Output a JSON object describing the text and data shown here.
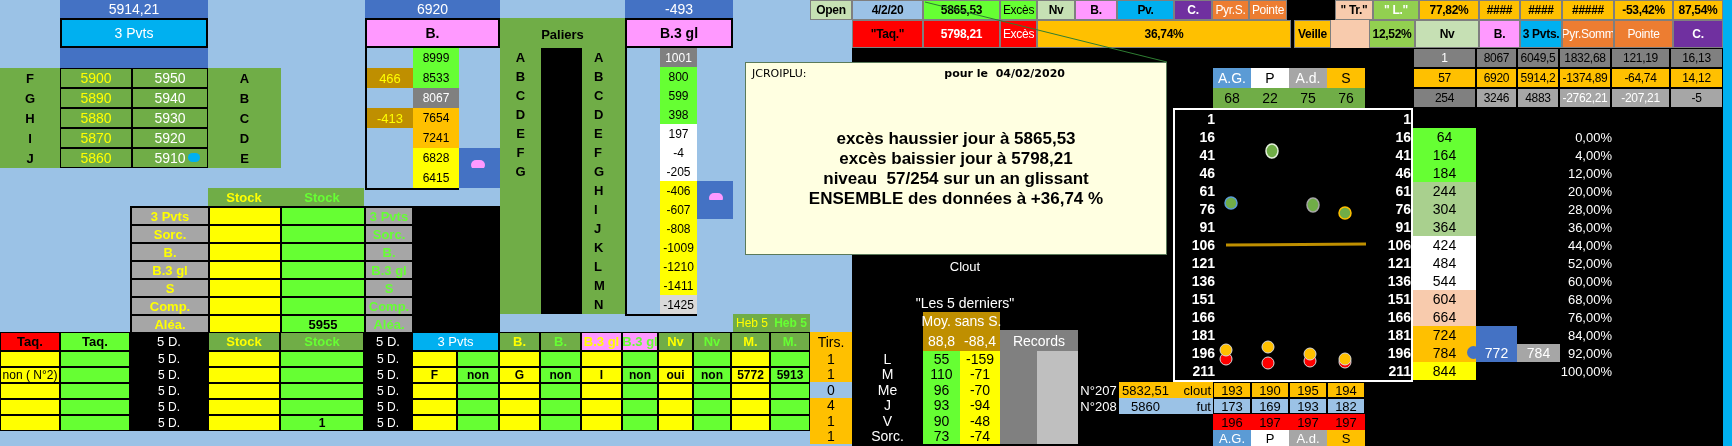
{
  "pivots": {
    "value": "5914,21",
    "title": "3 Pvts",
    "rows": [
      {
        "left": "F",
        "low": "5900",
        "high": "5950",
        "right": "A",
        "marked": false
      },
      {
        "left": "G",
        "low": "5890",
        "high": "5940",
        "right": "B",
        "marked": false
      },
      {
        "left": "H",
        "low": "5880",
        "high": "5930",
        "right": "C",
        "marked": false
      },
      {
        "left": "I",
        "low": "5870",
        "high": "5920",
        "right": "D",
        "marked": false
      },
      {
        "left": "J",
        "low": "5860",
        "high": "5910",
        "right": "E",
        "marked": true
      }
    ]
  },
  "b_block": {
    "value": "6920",
    "title": "B.",
    "rows": [
      {
        "value": "8999",
        "color": "#66ff33",
        "highlight": false,
        "marked": false
      },
      {
        "diff": "466",
        "value": "8533",
        "color": "#66ff33",
        "highlight": false,
        "marked": false
      },
      {
        "value": "8067",
        "color": "#808080",
        "highlight": false,
        "marked": false
      },
      {
        "diff": "-413",
        "value": "7654",
        "color": "#ffc000",
        "highlight": false,
        "marked": false
      },
      {
        "value": "7241",
        "color": "#ffc000",
        "highlight": false,
        "marked": false
      },
      {
        "value": "6828",
        "color": "#ffff00",
        "highlight": true,
        "marked": true
      },
      {
        "value": "6415",
        "color": "#ffff00",
        "highlight": true,
        "marked": false
      }
    ]
  },
  "paliers": {
    "title": "Paliers",
    "left_labels": [
      "A",
      "B",
      "C",
      "D",
      "E",
      "F",
      "G"
    ],
    "right_labels": [
      "A",
      "B",
      "C",
      "D",
      "E",
      "F",
      "G",
      "H",
      "I",
      "J",
      "K",
      "L",
      "M",
      "N"
    ]
  },
  "b3_block": {
    "value": "-493",
    "title": "B.3 gl",
    "rows": [
      {
        "value": "1001",
        "color": "#808080",
        "highlight": false,
        "marked": false
      },
      {
        "value": "800",
        "color": "#66ff33",
        "highlight": false,
        "marked": false
      },
      {
        "value": "599",
        "color": "#66ff33",
        "highlight": false,
        "marked": false
      },
      {
        "value": "398",
        "color": "#66ff33",
        "highlight": false,
        "marked": false
      },
      {
        "value": "197",
        "color": "#ffffff",
        "highlight": false,
        "marked": false
      },
      {
        "value": "-4",
        "color": "#ffffff",
        "highlight": false,
        "marked": false
      },
      {
        "value": "-205",
        "color": "#ffffff",
        "highlight": false,
        "marked": false
      },
      {
        "value": "-406",
        "color": "#ffff00",
        "highlight": true,
        "marked": true
      },
      {
        "value": "-607",
        "color": "#ffff00",
        "highlight": true,
        "marked": false
      },
      {
        "value": "-808",
        "color": "#ffff00",
        "highlight": false,
        "marked": false
      },
      {
        "value": "-1009",
        "color": "#ffff00",
        "highlight": false,
        "marked": false
      },
      {
        "value": "-1210",
        "color": "#ffff00",
        "highlight": false,
        "marked": false
      },
      {
        "value": "-1411",
        "color": "#ffff00",
        "highlight": false,
        "marked": false
      },
      {
        "value": "-1425",
        "color": "#d9d9d9",
        "highlight": false,
        "marked": false
      }
    ]
  },
  "stock_table": {
    "headers": [
      "Stock",
      "Stock"
    ],
    "rows": [
      {
        "label": "3 Pvts",
        "mirror": "3 Pvts"
      },
      {
        "label": "Sorc.",
        "mirror": "Sorc."
      },
      {
        "label": "B.",
        "mirror": "B."
      },
      {
        "label": "B.3 gl",
        "mirror": "B.3 gl"
      },
      {
        "label": "S",
        "mirror": "S"
      },
      {
        "label": "Comp.",
        "mirror": "Comp."
      },
      {
        "label": "Aléa.",
        "mirror": "Aléa.",
        "stock": "5955"
      }
    ]
  },
  "lower_table": {
    "heb": [
      "Heb 5",
      "Heb 5"
    ],
    "headers": [
      {
        "text": "Taq.",
        "color": "#ff0000",
        "kind": "dark"
      },
      {
        "text": "Taq.",
        "color": "#66ff33",
        "kind": "dark"
      },
      {
        "text": "5 D.",
        "color": "#000000",
        "kind": "soft"
      },
      {
        "text": "Stock",
        "color": "#70ad47",
        "kind": "gold"
      },
      {
        "text": "Stock",
        "color": "#70ad47",
        "kind": "lime"
      },
      {
        "text": "5 D.",
        "color": "#000000",
        "kind": "soft"
      },
      {
        "text": "3 Pvts",
        "color": "#00b0f0",
        "kind": "soft"
      },
      {
        "text": "B.",
        "color": "#70ad47",
        "kind": "gold"
      },
      {
        "text": "B.",
        "color": "#70ad47",
        "kind": "lime"
      },
      {
        "text": "B.3 gl",
        "color": "#ff99ff",
        "kind": "gold"
      },
      {
        "text": "B.3 gl",
        "color": "#ff99ff",
        "kind": "lime"
      },
      {
        "text": "Nv",
        "color": "#70ad47",
        "kind": "gold"
      },
      {
        "text": "Nv",
        "color": "#70ad47",
        "kind": "lime"
      },
      {
        "text": "M.",
        "color": "#70ad47",
        "kind": "gold"
      },
      {
        "text": "M.",
        "color": "#70ad47",
        "kind": "lime"
      }
    ],
    "rows": [
      {
        "d5_a": "5 D.",
        "d5_b": "5 D."
      },
      {
        "taq": "non ( N°2)",
        "d5_a": "5 D.",
        "d5_b": "5 D.",
        "pvts_a": "F",
        "pvts_b": "non",
        "b_a": "G",
        "b_b": "non",
        "b3_a": "I",
        "b3_b": "non",
        "nv_a": "oui",
        "nv_b": "non",
        "m_a": "5772",
        "m_b": "5913"
      },
      {
        "d5_a": "5 D.",
        "d5_b": "5 D."
      },
      {
        "d5_a": "5 D.",
        "d5_b": "5 D."
      },
      {
        "d5_a": "5 D.",
        "stock_b": "1",
        "d5_b": "5 D."
      }
    ]
  },
  "top_bar": {
    "row_1": [
      {
        "text": "Open",
        "color": "#c6e0b4",
        "kind": "dark"
      },
      {
        "text": "4/2/20",
        "color": "#9bc2e6",
        "kind": "dark"
      },
      {
        "text": "5865,53",
        "color": "#66ff33",
        "kind": "dark"
      },
      {
        "text": "Excès",
        "color": "#66ff33",
        "kind": "plain"
      },
      {
        "text": "Nv",
        "color": "#c6e0b4",
        "kind": "dark"
      },
      {
        "text": "B.",
        "color": "#ff99ff",
        "kind": "dark"
      },
      {
        "text": "Pv.",
        "color": "#00b0f0",
        "kind": "dark"
      },
      {
        "text": "C.",
        "color": "#7030a0",
        "kind": "light"
      },
      {
        "text": "Pyr.S.",
        "color": "#ed7d31",
        "kind": "soft"
      },
      {
        "text": "Pointe",
        "color": "#ed7d31",
        "kind": "soft"
      },
      {
        "color": "#000000",
        "kind": "plain"
      },
      {
        "text": "\" Tr.\"",
        "color": "#f8cbad",
        "kind": "dark"
      },
      {
        "text": "\" L.\"",
        "color": "#92d050",
        "kind": "light"
      },
      {
        "text": "77,82%",
        "color": "#ffc000",
        "kind": "dark"
      },
      {
        "text": "####",
        "color": "#ffc000",
        "kind": "dark"
      },
      {
        "text": "####",
        "color": "#ffc000",
        "kind": "dark"
      },
      {
        "text": "#####",
        "color": "#ffc000",
        "kind": "dark"
      },
      {
        "text": "-53,42%",
        "color": "#ffc000",
        "kind": "dark"
      },
      {
        "text": "87,54%",
        "color": "#ffc000",
        "kind": "dark"
      }
    ],
    "row_2": [
      {
        "text": "\"Taq.\"",
        "color": "#ff0000",
        "kind": "dark"
      },
      {
        "text": "5798,21",
        "color": "#ff0000",
        "kind": "light"
      },
      {
        "text": "Excès",
        "color": "#ff0000",
        "kind": "soft"
      },
      {
        "text": "36,74%",
        "color": "#ffc000",
        "kind": "dark"
      },
      {
        "color": "#000000",
        "kind": "plain"
      },
      {
        "text": "Veille",
        "color": "#ffc000",
        "kind": "dark"
      },
      {
        "color": "#f8cbad",
        "kind": "plain"
      },
      {
        "text": "12,52%",
        "color": "#92d050",
        "kind": "dark"
      },
      {
        "text": "Nv",
        "color": "#c6e0b4",
        "kind": "dark"
      },
      {
        "text": "B.",
        "color": "#ff99ff",
        "kind": "dark"
      },
      {
        "text": "3 Pvts.",
        "color": "#00b0f0",
        "kind": "dark"
      },
      {
        "text": "Pyr.Somm",
        "color": "#ed7d31",
        "kind": "soft"
      },
      {
        "text": "Pointe",
        "color": "#ed7d31",
        "kind": "soft"
      },
      {
        "text": "C.",
        "color": "#7030a0",
        "kind": "light"
      }
    ]
  },
  "summary_table": {
    "rows": [
      [
        {
          "text": "1",
          "color": "#808080",
          "kind": "soft"
        },
        {
          "text": "8067",
          "color": "#808080",
          "kind": "plain"
        },
        {
          "text": "6049,5",
          "color": "#808080",
          "kind": "plain"
        },
        {
          "text": "1832,68",
          "color": "#808080",
          "kind": "plain"
        },
        {
          "text": "121,19",
          "color": "#808080",
          "kind": "plain"
        },
        {
          "text": "16,13",
          "color": "#808080",
          "kind": "plain"
        }
      ],
      [
        {
          "text": "57",
          "color": "#ffc000",
          "kind": "plain"
        },
        {
          "text": "6920",
          "color": "#ffc000",
          "kind": "plain"
        },
        {
          "text": "5914,2",
          "color": "#ffc000",
          "kind": "plain"
        },
        {
          "text": "-1374,89",
          "color": "#ffc000",
          "kind": "plain"
        },
        {
          "text": "-64,74",
          "color": "#ffc000",
          "kind": "plain"
        },
        {
          "text": "14,12",
          "color": "#ffc000",
          "kind": "plain"
        }
      ],
      [
        {
          "text": "254",
          "color": "#808080",
          "kind": "plain"
        },
        {
          "text": "3246",
          "color": "#a6a6a6",
          "kind": "plain"
        },
        {
          "text": "4883",
          "color": "#a6a6a6",
          "kind": "plain"
        },
        {
          "text": "-2762,21",
          "color": "#a6a6a6",
          "kind": "soft"
        },
        {
          "text": "-207,21",
          "color": "#a6a6a6",
          "kind": "soft"
        },
        {
          "text": "-5",
          "color": "#a6a6a6",
          "kind": "plain"
        }
      ]
    ]
  },
  "groups": {
    "headers": [
      {
        "text": "A.G.",
        "color": "#5b9bd5",
        "kind": "soft"
      },
      {
        "text": "P",
        "color": "#ffffff",
        "kind": "plain"
      },
      {
        "text": "A.d.",
        "color": "#a6a6a6",
        "kind": "soft"
      },
      {
        "text": "S",
        "color": "#ffc000",
        "kind": "plain"
      }
    ],
    "values": [
      "68",
      "22",
      "75",
      "76"
    ]
  },
  "note": {
    "author": "JCROIPLU:",
    "date": "pour le  04/02/2020",
    "lines": [
      "excès haussier jour à 5865,53",
      "excès baissier jour à 5798,21",
      "niveau  57/254 sur un an glissant",
      "ENSEMBLE des données à +36,74 %"
    ]
  },
  "tirs": {
    "title": "Tirs.",
    "rows": [
      {
        "text": "1",
        "color": "#ffc000"
      },
      {
        "text": "1",
        "color": "#ffc000"
      },
      {
        "text": "0",
        "color": "#9bc2e6"
      },
      {
        "text": "4",
        "color": "#ffc000"
      },
      {
        "text": "1",
        "color": "#ffc000"
      },
      {
        "text": "1",
        "color": "#ffc000"
      }
    ]
  },
  "recent": {
    "clout": "Clout",
    "title": "\"Les 5 derniers\"",
    "average_title": "Moy. sans S.",
    "averages": [
      "88,8",
      "-88,4"
    ],
    "records_title": "Records",
    "rows": [
      {
        "day": "L",
        "up": "55",
        "down": "-159"
      },
      {
        "day": "M",
        "up": "110",
        "down": "-71"
      },
      {
        "day": "Me",
        "up": "96",
        "down": "-70"
      },
      {
        "day": "J",
        "up": "93",
        "down": "-94"
      },
      {
        "day": "V",
        "up": "90",
        "down": "-48"
      },
      {
        "day": "Sorc.",
        "up": "73",
        "down": "-74"
      }
    ]
  },
  "ladder": {
    "left_ticks": [
      "1",
      "16",
      "41",
      "46",
      "61",
      "76",
      "91",
      "106",
      "121",
      "136",
      "151",
      "166",
      "181",
      "196",
      "211"
    ],
    "right_ticks": [
      "1",
      "16",
      "41",
      "46",
      "61",
      "76",
      "91",
      "106",
      "121",
      "136",
      "151",
      "166",
      "181",
      "196",
      "211"
    ],
    "levels": [
      {
        "value": "64",
        "color": "#66ff33",
        "marked": false
      },
      {
        "value": "164",
        "color": "#66ff33",
        "marked": false
      },
      {
        "value": "184",
        "color": "#66ff33",
        "marked": false
      },
      {
        "value": "244",
        "color": "#a9d08e",
        "marked": false
      },
      {
        "value": "304",
        "color": "#a9d08e",
        "marked": false
      },
      {
        "value": "364",
        "color": "#a9d08e",
        "marked": false
      },
      {
        "value": "424",
        "color": "#ffffff",
        "marked": false
      },
      {
        "value": "484",
        "color": "#ffffff",
        "marked": false
      },
      {
        "value": "544",
        "color": "#ffffff",
        "marked": false
      },
      {
        "value": "604",
        "color": "#f8cbad",
        "marked": false
      },
      {
        "value": "664",
        "color": "#f8cbad",
        "marked": false
      },
      {
        "value": "724",
        "color": "#ffc000",
        "marked": false
      },
      {
        "value": "784",
        "color": "#ffc000",
        "marked": true
      },
      {
        "value": "844",
        "color": "#ffff00",
        "marked": false
      }
    ],
    "percentages": [
      "0,00%",
      "4,00%",
      "12,00%",
      "20,00%",
      "28,00%",
      "36,00%",
      "44,00%",
      "52,00%",
      "60,00%",
      "68,00%",
      "76,00%",
      "84,00%",
      "92,00%",
      "100,00%"
    ],
    "current": {
      "blue": "772",
      "gray": "784"
    }
  },
  "records": {
    "rows": [
      {
        "label": "N°207",
        "price": "5832,51",
        "tag": "clout",
        "values": [
          "193",
          "190",
          "195",
          "194"
        ],
        "color": "#ffc000"
      },
      {
        "label": "N°208",
        "price": "5860",
        "tag": "fut",
        "values": [
          "173",
          "169",
          "193",
          "182"
        ],
        "color": "#9bc2e6"
      }
    ],
    "max_values": [
      "196",
      "197",
      "197",
      "197"
    ],
    "legend": [
      {
        "text": "A.G.",
        "color": "#5b9bd5",
        "kind": "soft"
      },
      {
        "text": "P",
        "color": "#ffffff",
        "kind": "plain"
      },
      {
        "text": "A.d.",
        "color": "#a6a6a6",
        "kind": "soft"
      },
      {
        "text": "S",
        "color": "#ffc000",
        "kind": "plain"
      }
    ]
  }
}
